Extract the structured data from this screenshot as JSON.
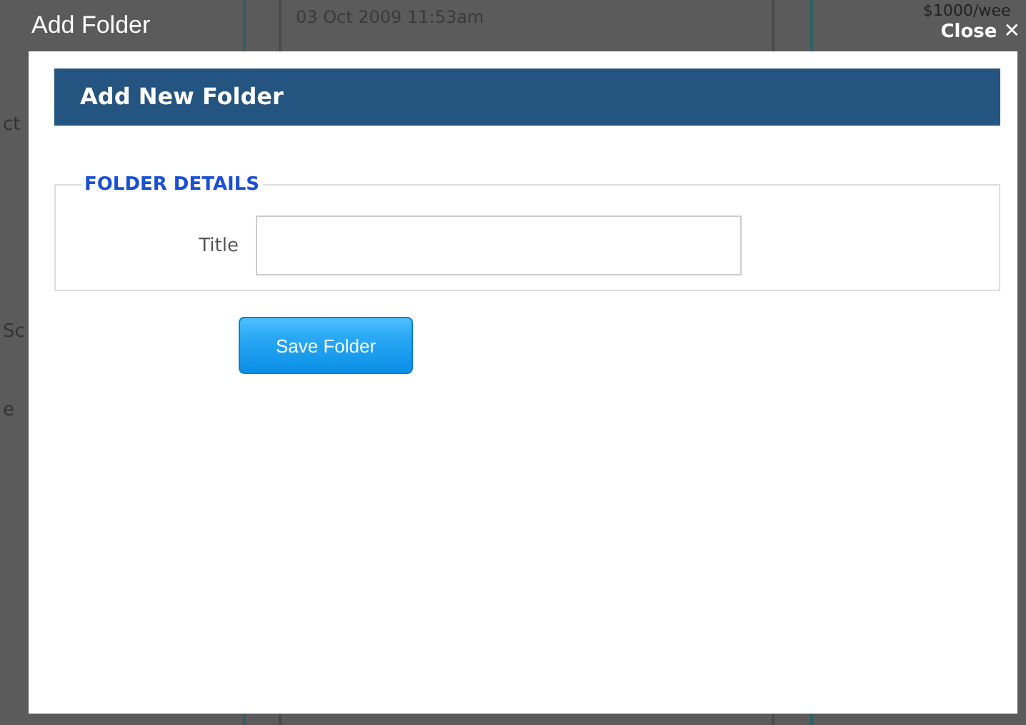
{
  "background": {
    "date": "03 Oct 2009 11:53am",
    "price": "$1000/wee",
    "fragments": [
      "ct",
      "Sc",
      "e"
    ]
  },
  "dialog": {
    "title": "Add Folder",
    "close": {
      "label": "Close",
      "icon": "✕"
    },
    "heading": "Add New Folder",
    "fieldset": {
      "legend": "FOLDER DETAILS",
      "fields": [
        {
          "label": "Title"
        }
      ]
    },
    "buttons": [
      "Save Folder"
    ]
  }
}
